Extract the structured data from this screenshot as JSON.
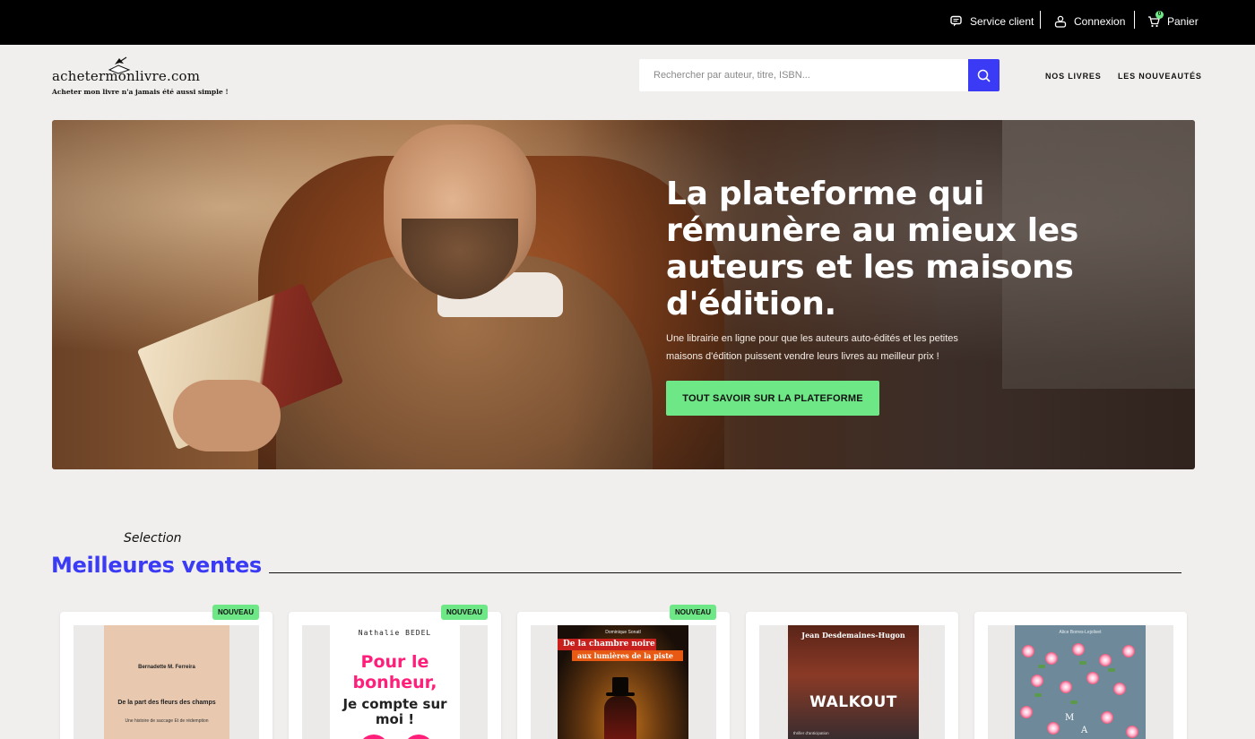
{
  "topbar": {
    "service_label": "Service client",
    "login_label": "Connexion",
    "cart_label": "Panier",
    "cart_count": "0"
  },
  "header": {
    "logo_main": "achetermonlivre.com",
    "logo_tagline": "Acheter mon livre n'a jamais été aussi simple !",
    "search_placeholder": "Rechercher par auteur, titre, ISBN...",
    "nav": [
      "NOS LIVRES",
      "LES NOUVEAUTÉS"
    ]
  },
  "hero": {
    "title": "La plateforme qui rémunère au mieux les auteurs et les maisons d'édition.",
    "subtitle": "Une librairie en ligne pour que les auteurs auto-édités et les petites maisons d'édition puissent vendre leurs livres au meilleur prix !",
    "cta": "TOUT SAVOIR SUR LA PLATEFORME"
  },
  "section": {
    "kicker": "Selection",
    "title": "Meilleures ventes"
  },
  "books": [
    {
      "badge": "NOUVEAU",
      "cover_author": "Bernadette M. Ferreira",
      "cover_title": "De la part des fleurs des champs",
      "cover_sub": "Une histoire de saccage Et de rédemption"
    },
    {
      "badge": "NOUVEAU",
      "cover_author": "Nathalie BEDEL",
      "cover_title_1": "Pour le bonheur,",
      "cover_title_2": "Je compte sur moi !"
    },
    {
      "badge": "NOUVEAU",
      "cover_author": "Dominique Sonatl",
      "cover_title_1": "De la chambre noire",
      "cover_title_2": "aux lumières de la piste"
    },
    {
      "badge": "",
      "cover_author": "Jean Desdemaines-Hugon",
      "cover_title": "WALKOUT",
      "cover_sub": "thriller d'anticipation"
    },
    {
      "badge": "",
      "cover_author": "Alice Borres-Lejolivet",
      "cover_letters": [
        "M",
        "A"
      ]
    }
  ],
  "colors": {
    "accent_blue": "#3b3bf5",
    "accent_green": "#6ee787",
    "topbar_bg": "#000000",
    "page_bg": "#f1efed"
  },
  "icons": {
    "service": "chat-bubble-icon",
    "login": "user-icon",
    "cart": "cart-icon",
    "search": "search-icon",
    "logo": "bird-on-book-icon"
  }
}
